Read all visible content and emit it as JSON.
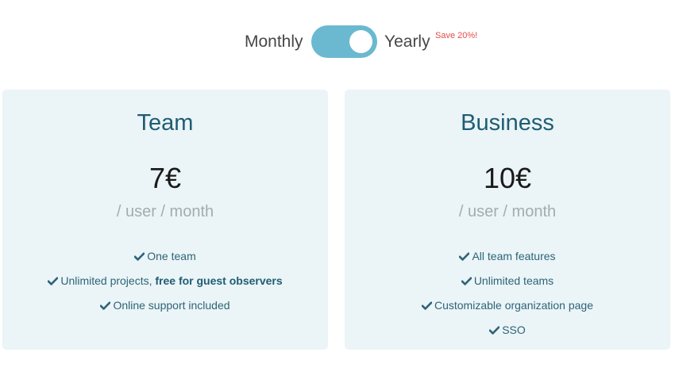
{
  "billing": {
    "monthly_label": "Monthly",
    "yearly_label": "Yearly",
    "save_badge": "Save 20%!",
    "selected": "yearly",
    "toggle_color": "#6ab9d0"
  },
  "plans": [
    {
      "name": "Team",
      "price": "7€",
      "unit": "/ user / month",
      "features": [
        {
          "icon": "check-icon",
          "text": "One team",
          "strong": ""
        },
        {
          "icon": "check-icon",
          "text": "Unlimited projects, ",
          "strong": "free for guest observers"
        },
        {
          "icon": "check-icon",
          "text": "Online support included",
          "strong": ""
        }
      ]
    },
    {
      "name": "Business",
      "price": "10€",
      "unit": "/ user / month",
      "features": [
        {
          "icon": "check-icon",
          "text": "All team features",
          "strong": ""
        },
        {
          "icon": "check-icon",
          "text": "Unlimited teams",
          "strong": ""
        },
        {
          "icon": "check-icon",
          "text": "Customizable organization page",
          "strong": ""
        },
        {
          "icon": "check-icon",
          "text": "SSO",
          "strong": ""
        }
      ]
    }
  ],
  "colors": {
    "card_background": "#ebf4f7",
    "plan_title": "#1e5d73",
    "feature_text": "#2d6478",
    "badge": "#e54b4b"
  }
}
